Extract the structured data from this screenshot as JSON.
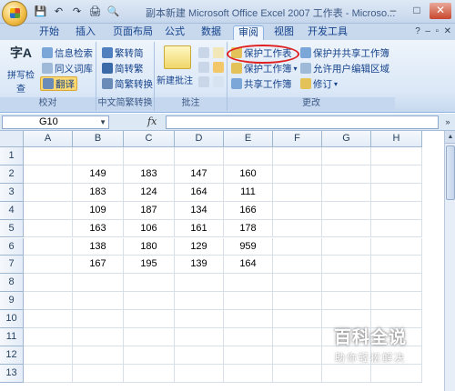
{
  "app": {
    "title": "副本新建 Microsoft Office Excel 2007 工作表 - Microso...",
    "qat": [
      "💾",
      "↶",
      "↷",
      "🖨",
      "🔍"
    ],
    "winbtns": [
      "–",
      "□",
      "✕"
    ]
  },
  "tabs": [
    "开始",
    "插入",
    "页面布局",
    "公式",
    "数据",
    "审阅",
    "视图",
    "开发工具"
  ],
  "active_tab": "审阅",
  "ribbon": {
    "proofing": {
      "big_label": "拼写检查",
      "big_glyph": "字A",
      "items": [
        "信息检索",
        "同义词库",
        "翻译"
      ],
      "label": "校对"
    },
    "chinese": {
      "items": [
        "繁转简",
        "简转繁",
        "简繁转换"
      ],
      "label": "中文简繁转换"
    },
    "comments": {
      "big_label": "新建批注",
      "label": "批注"
    },
    "changes": {
      "left_items": [
        "保护工作表",
        "保护工作簿",
        "共享工作簿"
      ],
      "right_items": [
        "保护并共享工作簿",
        "允许用户编辑区域",
        "修订"
      ],
      "label": "更改"
    }
  },
  "formula_bar": {
    "name_box": "G10",
    "fx": "fx",
    "value": ""
  },
  "sheet": {
    "columns": [
      "A",
      "B",
      "C",
      "D",
      "E",
      "F",
      "G",
      "H"
    ],
    "rows": [
      "1",
      "2",
      "3",
      "4",
      "5",
      "6",
      "7",
      "8",
      "9",
      "10",
      "11",
      "12",
      "13"
    ],
    "cells": [
      [
        "",
        "",
        "",
        "",
        "",
        "",
        "",
        ""
      ],
      [
        "",
        "149",
        "183",
        "147",
        "160",
        "",
        "",
        ""
      ],
      [
        "",
        "183",
        "124",
        "164",
        "111",
        "",
        "",
        ""
      ],
      [
        "",
        "109",
        "187",
        "134",
        "166",
        "",
        "",
        ""
      ],
      [
        "",
        "163",
        "106",
        "161",
        "178",
        "",
        "",
        ""
      ],
      [
        "",
        "138",
        "180",
        "129",
        "959",
        "",
        "",
        ""
      ],
      [
        "",
        "167",
        "195",
        "139",
        "164",
        "",
        "",
        ""
      ],
      [
        "",
        "",
        "",
        "",
        "",
        "",
        "",
        ""
      ],
      [
        "",
        "",
        "",
        "",
        "",
        "",
        "",
        ""
      ],
      [
        "",
        "",
        "",
        "",
        "",
        "",
        "",
        ""
      ],
      [
        "",
        "",
        "",
        "",
        "",
        "",
        "",
        ""
      ],
      [
        "",
        "",
        "",
        "",
        "",
        "",
        "",
        ""
      ],
      [
        "",
        "",
        "",
        "",
        "",
        "",
        "",
        ""
      ]
    ]
  },
  "watermark": {
    "line1": "百科全说",
    "line2": "助你轻松解决"
  },
  "colors": {
    "highlight_oval": "#e02020",
    "ribbon_text": "#15428b",
    "selected_button": "#fbd872"
  }
}
